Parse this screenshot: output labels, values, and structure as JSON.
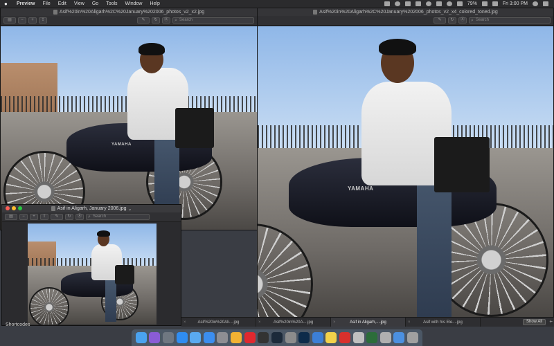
{
  "menubar": {
    "app_name": "Preview",
    "items": [
      "File",
      "Edit",
      "View",
      "Go",
      "Tools",
      "Window",
      "Help"
    ],
    "battery": "79%",
    "clock": "Fri 3:00 PM"
  },
  "windows": {
    "win1": {
      "title": "Asif%20in%20Aligarh%2C%20January%202006_photos_v2_x2.jpg",
      "search_placeholder": "Search"
    },
    "win2": {
      "title": "Asif%20in%20Aligarh%2C%20January%202006_photos_v2_x4_colored_toned.jpg",
      "search_placeholder": "Search"
    },
    "win3": {
      "title": "Asif in Aligarh, January 2006.jpg",
      "search_placeholder": "Search"
    }
  },
  "photo": {
    "tank_label": "YAMAHA"
  },
  "tabs": [
    "Asif%20in%20Ali....jpg",
    "Asif%20in%20A....jpg",
    "Asif in Aligarh,....jpg",
    "Asif with his Ele....jpg"
  ],
  "tabbar": {
    "show_all": "Show All",
    "add_icon": "plus-icon"
  },
  "desktop": {
    "sidebar_label": "Shortcodes"
  },
  "dock_icons": [
    {
      "name": "finder-icon",
      "color": "#4aa3f0"
    },
    {
      "name": "siri-icon",
      "color": "#8a5cd6"
    },
    {
      "name": "launchpad-icon",
      "color": "#6f7781"
    },
    {
      "name": "safari-icon",
      "color": "#2f8df2"
    },
    {
      "name": "mail-icon",
      "color": "#5aaaf0"
    },
    {
      "name": "app-store-icon",
      "color": "#3b8ef0"
    },
    {
      "name": "system-preferences-icon",
      "color": "#8e8e93"
    },
    {
      "name": "chrome-icon",
      "color": "#f2b233"
    },
    {
      "name": "opera-icon",
      "color": "#e0282f"
    },
    {
      "name": "final-cut-icon",
      "color": "#333"
    },
    {
      "name": "lightroom-icon",
      "color": "#1c2a3a"
    },
    {
      "name": "photos-icon",
      "color": "#8c8c8c"
    },
    {
      "name": "photoshop-icon",
      "color": "#0d2b4a"
    },
    {
      "name": "s-app-icon",
      "color": "#3c7fd6"
    },
    {
      "name": "notes-icon",
      "color": "#f3d24a"
    },
    {
      "name": "adblock-icon",
      "color": "#d9302c"
    },
    {
      "name": "preview-icon",
      "color": "#c0c0c0"
    },
    {
      "name": "spreadsheet-icon",
      "color": "#2c6d3a"
    },
    {
      "name": "screenshot-icon",
      "color": "#b0b0b0"
    },
    {
      "name": "downloads-icon",
      "color": "#4b90e0"
    },
    {
      "name": "trash-icon",
      "color": "#a0a0a0"
    }
  ]
}
